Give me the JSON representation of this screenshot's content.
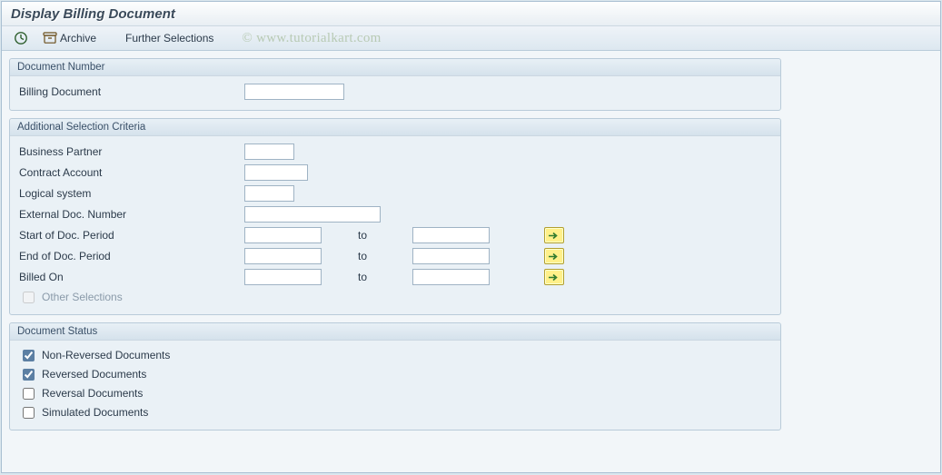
{
  "title": "Display Billing Document",
  "toolbar": {
    "execute_tip": "Execute",
    "archive_label": "Archive",
    "further_label": "Further Selections"
  },
  "watermark": "© www.tutorialkart.com",
  "groups": {
    "doc_num": {
      "title": "Document Number",
      "fields": {
        "billing_doc": {
          "label": "Billing Document",
          "value": ""
        }
      }
    },
    "add_sel": {
      "title": "Additional Selection Criteria",
      "fields": {
        "bp": {
          "label": "Business Partner",
          "value": ""
        },
        "contract": {
          "label": "Contract Account",
          "value": ""
        },
        "logical": {
          "label": "Logical system",
          "value": ""
        },
        "extdoc": {
          "label": "External Doc. Number",
          "value": ""
        },
        "startdoc": {
          "label": "Start of Doc. Period",
          "low": "",
          "high": ""
        },
        "enddoc": {
          "label": "End of Doc. Period",
          "low": "",
          "high": ""
        },
        "billedon": {
          "label": "Billed On",
          "low": "",
          "high": ""
        },
        "other": {
          "label": "Other Selections",
          "checked": false
        }
      },
      "to_text": "to"
    },
    "status": {
      "title": "Document Status",
      "items": {
        "nonrev": {
          "label": "Non-Reversed Documents",
          "checked": true
        },
        "rev": {
          "label": "Reversed Documents",
          "checked": true
        },
        "reversal": {
          "label": "Reversal Documents",
          "checked": false
        },
        "sim": {
          "label": "Simulated Documents",
          "checked": false
        }
      }
    }
  }
}
